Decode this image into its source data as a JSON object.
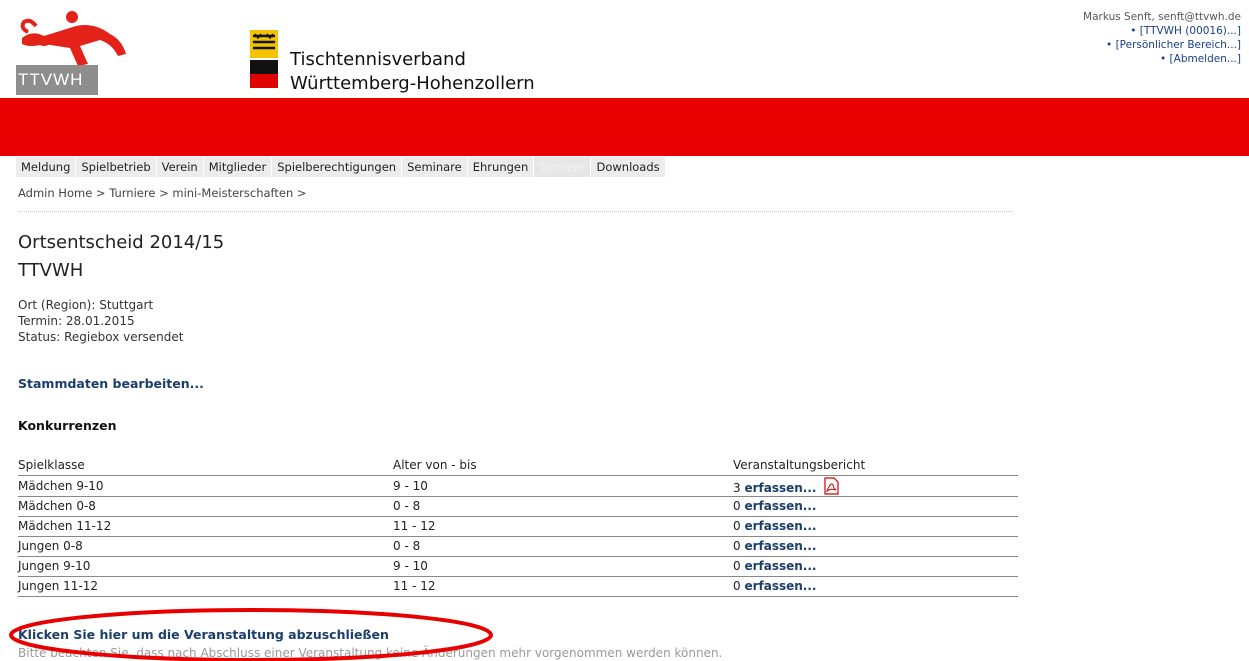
{
  "header": {
    "logo_text": "TTVWH",
    "org_line1": "Tischtennisverband",
    "org_line2": "Württemberg-Hohenzollern",
    "user": "Markus Senft, senft@ttvwh.de",
    "links": [
      "• [TTVWH (00016)...]",
      "• [Persönlicher Bereich...]",
      "• [Abmelden...]"
    ]
  },
  "nav": [
    "Meldung",
    "Spielbetrieb",
    "Verein",
    "Mitglieder",
    "Spielberechtigungen",
    "Seminare",
    "Ehrungen",
    "Turniere",
    "Downloads"
  ],
  "breadcrumb": "Admin Home > Turniere > mini-Meisterschaften >",
  "title": "Ortsentscheid 2014/15",
  "subtitle": "TTVWH",
  "info": {
    "ort": "Ort (Region): Stuttgart",
    "termin": "Termin: 28.01.2015",
    "status": "Status: Regiebox versendet"
  },
  "edit_link": "Stammdaten bearbeiten...",
  "section_heading": "Konkurrenzen",
  "table": {
    "headers": [
      "Spielklasse",
      "Alter von - bis",
      "Veranstaltungsbericht"
    ],
    "rows": [
      {
        "klasse": "Mädchen 9-10",
        "alter": "9 - 10",
        "count": "3",
        "action": "erfassen..."
      },
      {
        "klasse": "Mädchen 0-8",
        "alter": "0 - 8",
        "count": "0",
        "action": "erfassen..."
      },
      {
        "klasse": "Mädchen 11-12",
        "alter": "11 - 12",
        "count": "0",
        "action": "erfassen..."
      },
      {
        "klasse": "Jungen 0-8",
        "alter": "0 - 8",
        "count": "0",
        "action": "erfassen..."
      },
      {
        "klasse": "Jungen 9-10",
        "alter": "9 - 10",
        "count": "0",
        "action": "erfassen..."
      },
      {
        "klasse": "Jungen 11-12",
        "alter": "11 - 12",
        "count": "0",
        "action": "erfassen..."
      }
    ]
  },
  "finish_link": "Klicken Sie hier um die Veranstaltung abzuschließen",
  "finish_note": "Bitte beachten Sie, dass nach Abschluss einer Veranstaltung keine Änderungen mehr vorgenommen werden können.",
  "colors": {
    "brand_red": "#e80000",
    "link": "#1a3e6e"
  }
}
